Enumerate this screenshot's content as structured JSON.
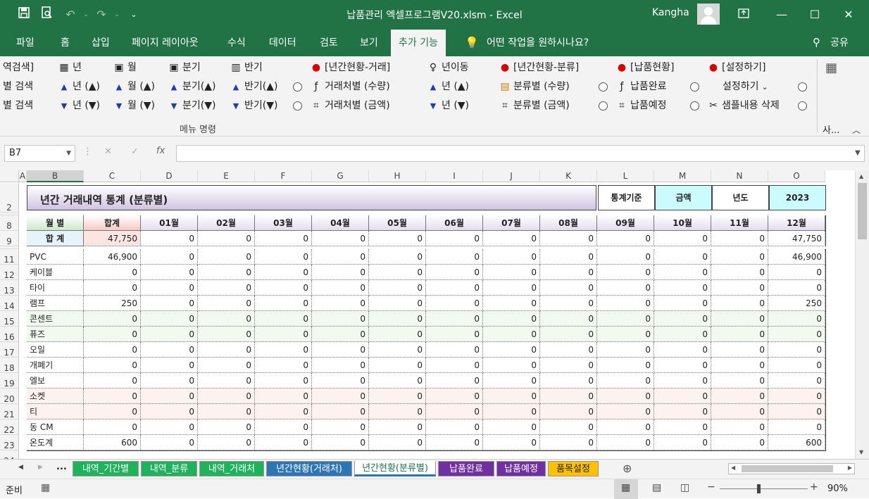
{
  "app": {
    "title": "납품관리 엑셀프로그램V20.xlsm  -  Excel",
    "user": "Kangha",
    "share_label": "공유",
    "tell_me": "어떤 작업을 원하시나요?"
  },
  "tabs": [
    "파일",
    "홈",
    "삽입",
    "페이지 레이아웃",
    "수식",
    "데이터",
    "검토",
    "보기",
    "추가 기능"
  ],
  "ribbon": {
    "group_label": "메뉴 명령",
    "truncated_label": "사...",
    "col1": [
      "역검색]",
      "별 검색",
      "별 검색"
    ],
    "year_head": "년",
    "month_head": "월",
    "quarter_head": "분기",
    "half_head": "반기",
    "year_up": "년 (▲)",
    "year_down": "년 (▼)",
    "month_up": "월 (▲)",
    "month_down": "월 (▼)",
    "quarter_up": "분기(▲)",
    "quarter_down": "분기(▼)",
    "half_up": "반기(▲)",
    "half_down": "반기(▼)",
    "annual_trade": "[년간현황-거래]",
    "by_partner_qty": "거래처별 (수량)",
    "by_partner_amt": "거래처별 (금액)",
    "year_move": "년이동",
    "year_move_up": "년 (▲)",
    "year_move_down": "년 (▼)",
    "annual_category": "[년간현황-분류]",
    "by_category_qty": "분류별 (수량)",
    "by_category_amt": "분류별 (금액)",
    "delivery_status": "[납품현황]",
    "delivery_done": "납품완료",
    "delivery_planned": "납품예정",
    "settings": "[설정하기]",
    "settings_item": "설정하기",
    "delete_sample": "샘플내용 삭제"
  },
  "formula_bar": {
    "name_box": "B7",
    "formula": ""
  },
  "columns": [
    "A",
    "B",
    "C",
    "D",
    "E",
    "F",
    "G",
    "H",
    "I",
    "J",
    "K",
    "L",
    "M",
    "N",
    "O"
  ],
  "sheet": {
    "title": "년간 거래내역 통계 (분류별)",
    "criteria_label": "통계기준",
    "criteria_value": "금액",
    "year_label": "년도",
    "year_value": "2023",
    "header_row_num": "8",
    "sum_row_num": "9",
    "title_row_num": "2",
    "row_hdr_label": "월    별",
    "sum_label": "합    계",
    "total_col_label": "합계",
    "months": [
      "01월",
      "02월",
      "03월",
      "04월",
      "05월",
      "06월",
      "07월",
      "08월",
      "09월",
      "10월",
      "11월",
      "12월"
    ],
    "sum_values": [
      "47,750",
      "0",
      "0",
      "0",
      "0",
      "0",
      "0",
      "0",
      "0",
      "0",
      "0",
      "0",
      "47,750"
    ],
    "rows": [
      {
        "num": "11",
        "label": "PVC",
        "values": [
          "46,900",
          "0",
          "0",
          "0",
          "0",
          "0",
          "0",
          "0",
          "0",
          "0",
          "0",
          "0",
          "46,900"
        ]
      },
      {
        "num": "12",
        "label": "케이블",
        "values": [
          "0",
          "0",
          "0",
          "0",
          "0",
          "0",
          "0",
          "0",
          "0",
          "0",
          "0",
          "0",
          "0"
        ]
      },
      {
        "num": "13",
        "label": "타이",
        "values": [
          "0",
          "0",
          "0",
          "0",
          "0",
          "0",
          "0",
          "0",
          "0",
          "0",
          "0",
          "0",
          "0"
        ]
      },
      {
        "num": "14",
        "label": "램프",
        "values": [
          "250",
          "0",
          "0",
          "0",
          "0",
          "0",
          "0",
          "0",
          "0",
          "0",
          "0",
          "0",
          "250"
        ]
      },
      {
        "num": "15",
        "label": "콘센트",
        "values": [
          "0",
          "0",
          "0",
          "0",
          "0",
          "0",
          "0",
          "0",
          "0",
          "0",
          "0",
          "0",
          "0"
        ]
      },
      {
        "num": "16",
        "label": "퓨즈",
        "values": [
          "0",
          "0",
          "0",
          "0",
          "0",
          "0",
          "0",
          "0",
          "0",
          "0",
          "0",
          "0",
          "0"
        ]
      },
      {
        "num": "17",
        "label": "오일",
        "values": [
          "0",
          "0",
          "0",
          "0",
          "0",
          "0",
          "0",
          "0",
          "0",
          "0",
          "0",
          "0",
          "0"
        ]
      },
      {
        "num": "18",
        "label": "개폐기",
        "values": [
          "0",
          "0",
          "0",
          "0",
          "0",
          "0",
          "0",
          "0",
          "0",
          "0",
          "0",
          "0",
          "0"
        ]
      },
      {
        "num": "19",
        "label": "엘보",
        "values": [
          "0",
          "0",
          "0",
          "0",
          "0",
          "0",
          "0",
          "0",
          "0",
          "0",
          "0",
          "0",
          "0"
        ]
      },
      {
        "num": "20",
        "label": "소켓",
        "values": [
          "0",
          "0",
          "0",
          "0",
          "0",
          "0",
          "0",
          "0",
          "0",
          "0",
          "0",
          "0",
          "0"
        ]
      },
      {
        "num": "21",
        "label": "티",
        "values": [
          "0",
          "0",
          "0",
          "0",
          "0",
          "0",
          "0",
          "0",
          "0",
          "0",
          "0",
          "0",
          "0"
        ]
      },
      {
        "num": "22",
        "label": "동 CM",
        "values": [
          "0",
          "0",
          "0",
          "0",
          "0",
          "0",
          "0",
          "0",
          "0",
          "0",
          "0",
          "0",
          "0"
        ]
      },
      {
        "num": "23",
        "label": "온도계",
        "values": [
          "600",
          "0",
          "0",
          "0",
          "0",
          "0",
          "0",
          "0",
          "0",
          "0",
          "0",
          "0",
          "600"
        ]
      }
    ],
    "next_row_num": "24"
  },
  "sheet_tabs": [
    {
      "label": "내역_기간별",
      "color": "#1fb25a"
    },
    {
      "label": "내역_분류",
      "color": "#1fb25a"
    },
    {
      "label": "내역_거래처",
      "color": "#1fb25a"
    },
    {
      "label": "년간현황(거래처)",
      "color": "#2e75b6"
    },
    {
      "label": "년간현황(분류별)",
      "color": "#dbe8f5",
      "active": true
    },
    {
      "label": "납품완료",
      "color": "#7030a0"
    },
    {
      "label": "납품예정",
      "color": "#7030a0"
    },
    {
      "label": "품목설정",
      "color": "#ffc000"
    }
  ],
  "sheet_nav_more": "...",
  "status": {
    "ready": "준비",
    "zoom": "90%"
  },
  "colors": {
    "excel_green": "#217346",
    "ribbon_bg": "#f3f3f3"
  }
}
